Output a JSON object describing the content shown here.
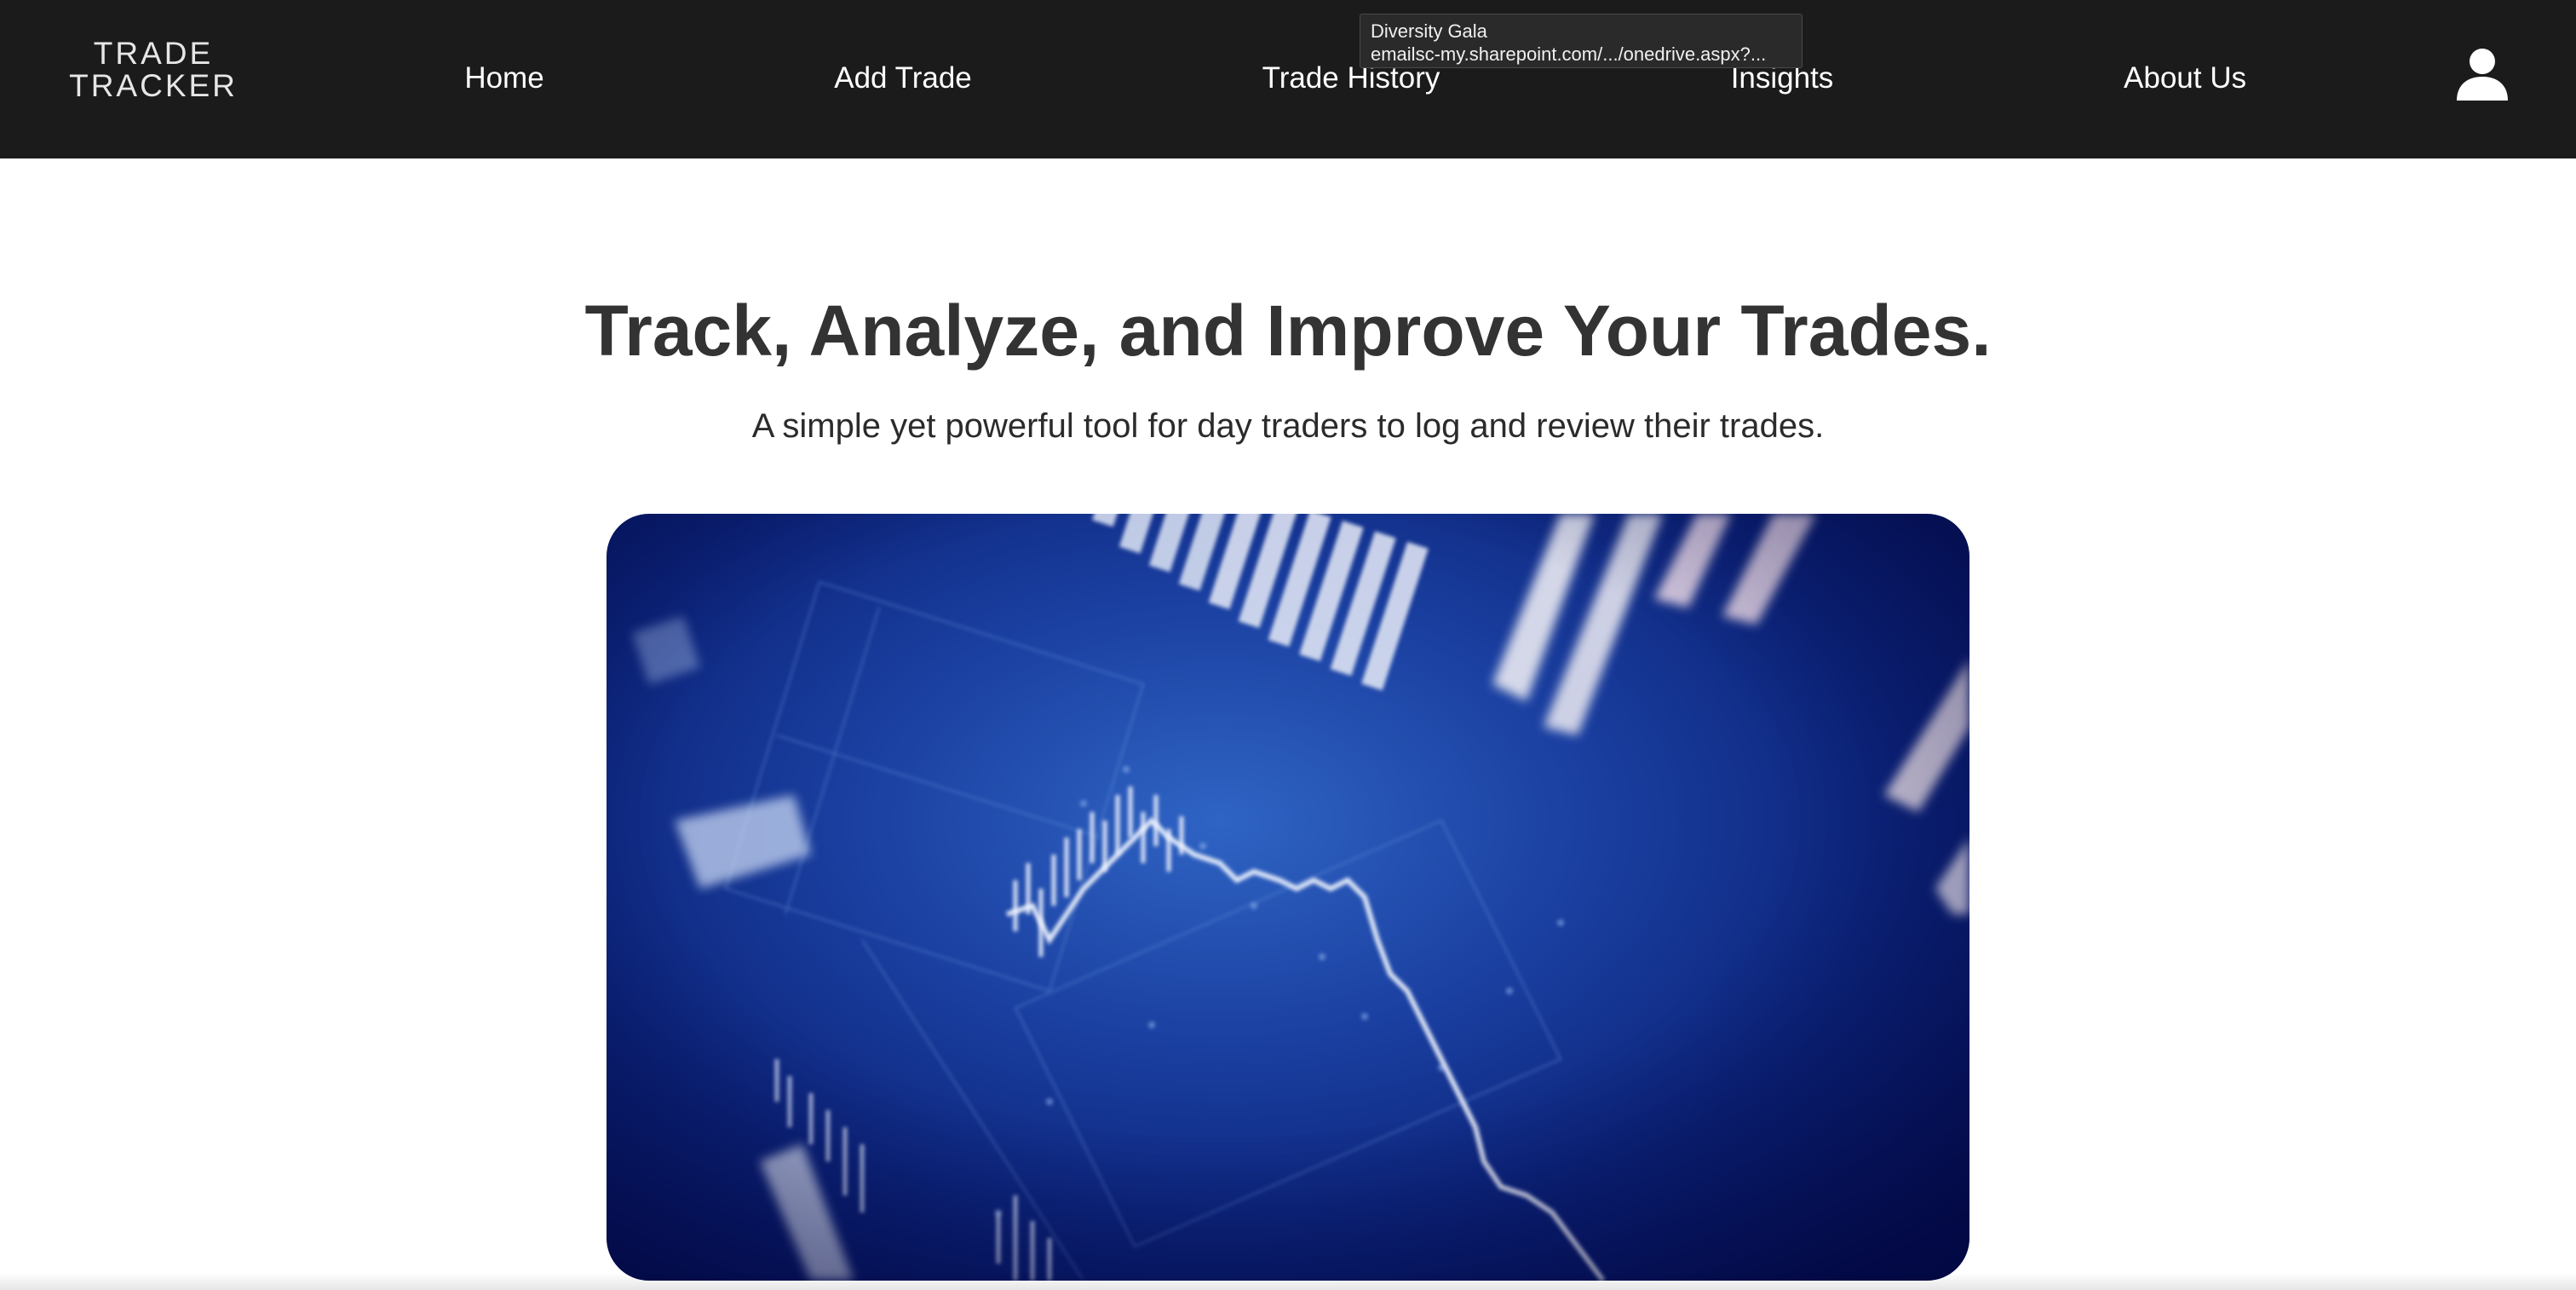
{
  "logo": {
    "line1": "TRADE",
    "line2": "TRACKER"
  },
  "nav": {
    "home": "Home",
    "add_trade": "Add Trade",
    "trade_history": "Trade History",
    "insights": "Insights",
    "about_us": "About Us"
  },
  "user_icon": "user-icon",
  "tooltip": {
    "title": "Diversity Gala",
    "url": "emailsc-my.sharepoint.com/.../onedrive.aspx?..."
  },
  "hero": {
    "title": "Track, Analyze, and Improve Your Trades.",
    "subtitle": "A simple yet powerful tool for day traders to log and review their trades."
  },
  "colors": {
    "navbar_bg": "#1b1b1b",
    "title_text": "#333333",
    "image_blue": "#1a3fa0"
  }
}
